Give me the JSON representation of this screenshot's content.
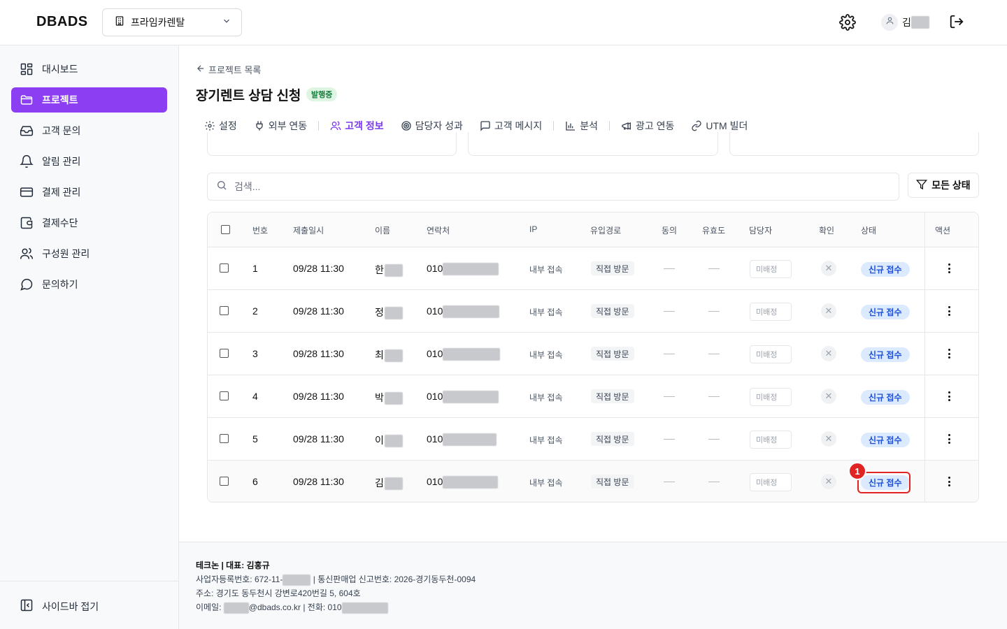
{
  "header": {
    "logo": "DBADS",
    "workspace": "프라임카렌탈",
    "user_name": "김"
  },
  "sidebar": {
    "items": [
      {
        "label": "대시보드",
        "icon": "dashboard-icon"
      },
      {
        "label": "프로젝트",
        "icon": "folder-icon",
        "active": true
      },
      {
        "label": "고객 문의",
        "icon": "inbox-icon"
      },
      {
        "label": "알림 관리",
        "icon": "bell-icon"
      },
      {
        "label": "결제 관리",
        "icon": "credit-card-icon"
      },
      {
        "label": "결제수단",
        "icon": "wallet-icon"
      },
      {
        "label": "구성원 관리",
        "icon": "users-icon"
      },
      {
        "label": "문의하기",
        "icon": "message-circle-icon"
      }
    ],
    "collapse_label": "사이드바 접기"
  },
  "project": {
    "back_label": "프로젝트 목록",
    "title": "장기렌트 상담 신청",
    "status": "발행중"
  },
  "tabs": [
    {
      "label": "설정",
      "icon": "gear-icon"
    },
    {
      "label": "외부 연동",
      "icon": "plug-icon"
    },
    {
      "label": "고객 정보",
      "icon": "users-icon",
      "active": true
    },
    {
      "label": "담당자 성과",
      "icon": "target-icon"
    },
    {
      "label": "고객 메시지",
      "icon": "message-square-icon"
    },
    {
      "label": "분석",
      "icon": "bar-chart-icon"
    },
    {
      "label": "광고 연동",
      "icon": "megaphone-icon"
    },
    {
      "label": "UTM 빌더",
      "icon": "link-icon"
    }
  ],
  "search": {
    "placeholder": "검색..."
  },
  "filter": {
    "label": "모든 상태"
  },
  "table": {
    "headers": [
      "번호",
      "제출일시",
      "이름",
      "연락처",
      "IP",
      "유입경로",
      "동의",
      "유효도",
      "담당자",
      "확인",
      "상태",
      "액션"
    ],
    "rows": [
      {
        "no": "1",
        "date": "09/28 11:30",
        "name": "한",
        "phone": "010",
        "ip": "내부 접속",
        "source": "직접 방문",
        "assignee": "미배정",
        "status": "신규 접수"
      },
      {
        "no": "2",
        "date": "09/28 11:30",
        "name": "정",
        "phone": "010",
        "ip": "내부 접속",
        "source": "직접 방문",
        "assignee": "미배정",
        "status": "신규 접수"
      },
      {
        "no": "3",
        "date": "09/28 11:30",
        "name": "최",
        "phone": "010",
        "ip": "내부 접속",
        "source": "직접 방문",
        "assignee": "미배정",
        "status": "신규 접수"
      },
      {
        "no": "4",
        "date": "09/28 11:30",
        "name": "박",
        "phone": "010",
        "ip": "내부 접속",
        "source": "직접 방문",
        "assignee": "미배정",
        "status": "신규 접수"
      },
      {
        "no": "5",
        "date": "09/28 11:30",
        "name": "이",
        "phone": "010",
        "ip": "내부 접속",
        "source": "직접 방문",
        "assignee": "미배정",
        "status": "신규 접수"
      },
      {
        "no": "6",
        "date": "09/28 11:30",
        "name": "김",
        "phone": "010",
        "ip": "내부 접속",
        "source": "직접 방문",
        "assignee": "미배정",
        "status": "신규 접수"
      }
    ]
  },
  "annotation": {
    "marker": "1"
  },
  "footer": {
    "line1": "테크논 | 대표: 김홍규",
    "line2_prefix": "사업자등록번호: 672-11-",
    "line2_suffix": "| 통신판매업 신고번호: 2026-경기동두천-0094",
    "line3": "주소: 경기도 동두천시 강변로420번길 5, 604호",
    "line4_prefix": "이메일: ",
    "line4_mid": "@dbads.co.kr | 전화: 010"
  },
  "colors": {
    "accent": "#8b3ef2",
    "status_badge_bg": "#dbeafe",
    "status_badge_text": "#1d4ed8",
    "published_bg": "#dff5e3",
    "published_text": "#15803d",
    "highlight": "#e02424"
  }
}
